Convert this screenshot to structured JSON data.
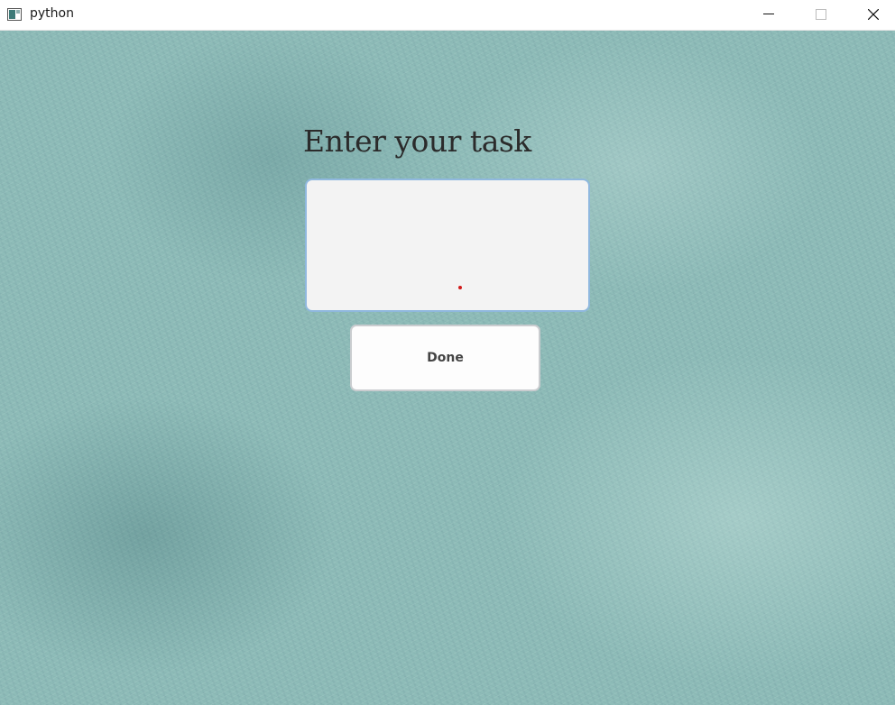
{
  "window": {
    "title": "python",
    "icon": "python-app-icon",
    "controls": {
      "minimize_icon": "minimize-icon",
      "maximize_icon": "maximize-icon",
      "close_icon": "close-icon"
    }
  },
  "main": {
    "heading": "Enter your task",
    "task_input": {
      "value": "",
      "placeholder": ""
    },
    "done_label": "Done"
  },
  "colors": {
    "background": "#8ebcb8",
    "input_border": "#8fb8de",
    "input_fill": "#f3f3f3",
    "cursor_dot": "#d11919"
  }
}
